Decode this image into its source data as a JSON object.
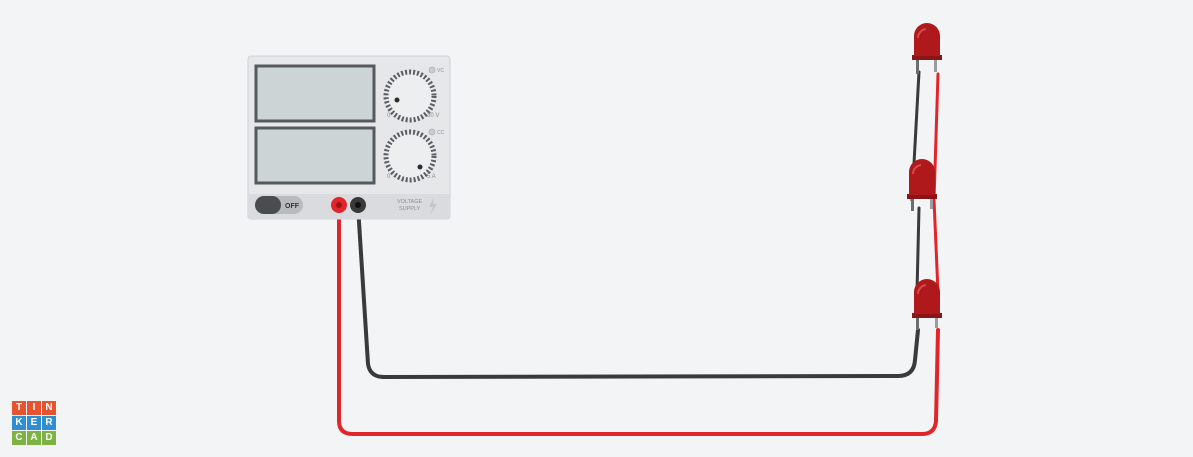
{
  "power_supply": {
    "voltage_indicator": "VC",
    "current_indicator": "CC",
    "voltage_knob_min": "0",
    "voltage_knob_max": "30 V",
    "current_knob_min": "0",
    "current_knob_max": "5 A",
    "power_switch": "OFF",
    "brand_line1": "VOLTAGE",
    "brand_line2": "SUPPLY"
  },
  "wires": {
    "positive_color": "#e0262a",
    "negative_color": "#3a3a3a"
  },
  "leds": {
    "color": "#b0191c",
    "count": 3
  },
  "logo": {
    "letters": [
      "T",
      "I",
      "N",
      "K",
      "E",
      "R",
      "C",
      "A",
      "D"
    ],
    "colors": [
      "#e8532f",
      "#e8532f",
      "#e8532f",
      "#2f8ed2",
      "#2f8ed2",
      "#2f8ed2",
      "#7cb342",
      "#7cb342",
      "#7cb342"
    ]
  }
}
